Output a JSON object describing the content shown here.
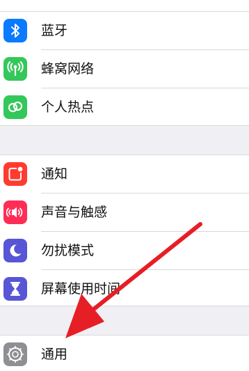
{
  "colors": {
    "background": "#efeff4",
    "cell": "#ffffff",
    "bluetooth": "#0a7aff",
    "cellular": "#34c759",
    "hotspot": "#34c759",
    "notifications": "#ff3b30",
    "sounds": "#ff2d55",
    "do_not_disturb": "#5856d6",
    "screen_time": "#5856d6",
    "general": "#8e8e93",
    "annotation_arrow": "#e61e25"
  },
  "group1": {
    "items": [
      {
        "label": "蓝牙",
        "icon": "bluetooth-icon"
      },
      {
        "label": "蜂窝网络",
        "icon": "cellular-antenna-icon"
      },
      {
        "label": "个人热点",
        "icon": "hotspot-link-icon"
      }
    ]
  },
  "group2": {
    "items": [
      {
        "label": "通知",
        "icon": "notification-badge-icon"
      },
      {
        "label": "声音与触感",
        "icon": "speaker-icon"
      },
      {
        "label": "勿扰模式",
        "icon": "moon-icon"
      },
      {
        "label": "屏幕使用时间",
        "icon": "hourglass-icon"
      }
    ]
  },
  "group3": {
    "items": [
      {
        "label": "通用",
        "icon": "gear-icon"
      }
    ]
  },
  "annotation": {
    "icon": "red-arrow-pointer"
  }
}
